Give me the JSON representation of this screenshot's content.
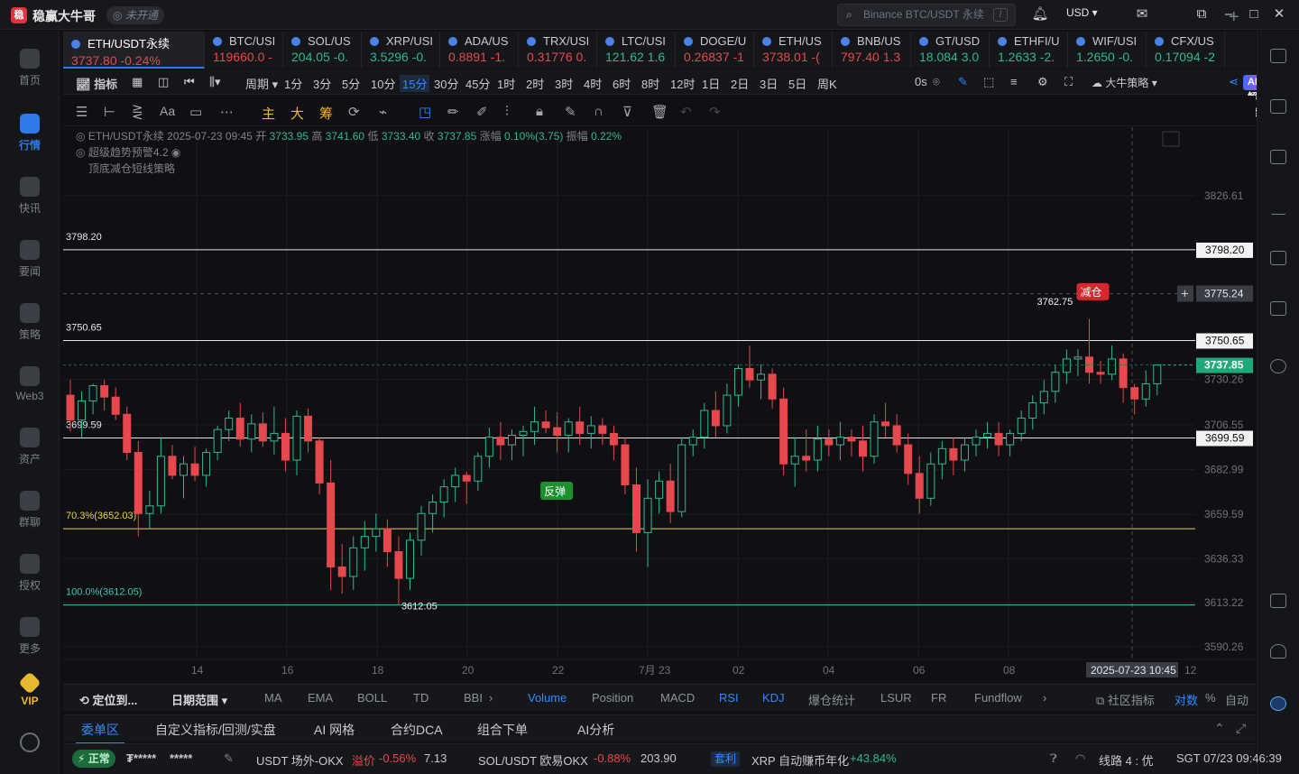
{
  "app": {
    "logo": "稳",
    "title": "稳赢大牛哥",
    "login_status": "未开通",
    "search_placeholder": "Binance BTC/USDT 永续",
    "search_hint": "/",
    "currency": "USD"
  },
  "left_nav": [
    {
      "label": "首页",
      "icon": "home-icon"
    },
    {
      "label": "行情",
      "icon": "market-chart-icon",
      "active": true
    },
    {
      "label": "快讯",
      "icon": "flash-news-icon"
    },
    {
      "label": "要闻",
      "icon": "news-icon"
    },
    {
      "label": "策略",
      "icon": "strategy-robot-icon"
    },
    {
      "label": "Web3",
      "icon": "web3-icon"
    },
    {
      "label": "资产",
      "icon": "wallet-icon"
    },
    {
      "label": "群聊",
      "icon": "chat-icon"
    },
    {
      "label": "授权",
      "icon": "authorize-icon"
    },
    {
      "label": "更多",
      "icon": "more-grid-icon"
    },
    {
      "label": "VIP",
      "icon": "vip-diamond-icon"
    }
  ],
  "tabs": [
    {
      "name": "ETH/USDT永续",
      "price": "3737.80",
      "change": "-0.24%",
      "dir": "dn",
      "active": true
    },
    {
      "name": "BTC/USI",
      "price": "119660.0",
      "change": "-",
      "dir": "dn"
    },
    {
      "name": "SOL/US",
      "price": "204.05",
      "change": "-0.",
      "dir": "up"
    },
    {
      "name": "XRP/USI",
      "price": "3.5296",
      "change": "-0.",
      "dir": "up"
    },
    {
      "name": "ADA/US",
      "price": "0.8891",
      "change": "-1.",
      "dir": "dn"
    },
    {
      "name": "TRX/USI",
      "price": "0.31776",
      "change": "0.",
      "dir": "dn"
    },
    {
      "name": "LTC/USI",
      "price": "121.62",
      "change": "1.6",
      "dir": "up"
    },
    {
      "name": "DOGE/U",
      "price": "0.26837",
      "change": "-1",
      "dir": "dn"
    },
    {
      "name": "ETH/US",
      "price": "3738.01",
      "change": "-(",
      "dir": "dn"
    },
    {
      "name": "BNB/US",
      "price": "797.40",
      "change": "1.3",
      "dir": "dn"
    },
    {
      "name": "GT/USD",
      "price": "18.084",
      "change": "3.0",
      "dir": "up"
    },
    {
      "name": "ETHFI/U",
      "price": "1.2633",
      "change": "-2.",
      "dir": "up"
    },
    {
      "name": "WIF/USI",
      "price": "1.2650",
      "change": "-0.",
      "dir": "up"
    },
    {
      "name": "CFX/US",
      "price": "0.17094",
      "change": "-2",
      "dir": "up"
    }
  ],
  "toolbar": {
    "indicator": "指标",
    "period": "周期",
    "timeframes": [
      "1分",
      "3分",
      "5分",
      "10分",
      "15分",
      "30分",
      "45分",
      "1时",
      "2时",
      "3时",
      "4时",
      "6时",
      "8时",
      "12时",
      "1日",
      "2日",
      "3日",
      "5日",
      "周K"
    ],
    "active_tf": "15分",
    "countdown": "0s",
    "strategy": "大牛策略",
    "ai": "AI解读"
  },
  "draw_tools": [
    "主",
    "大",
    "筹"
  ],
  "chart_info": {
    "symbol": "ETH/USDT永续",
    "datetime": "2025-07-23 09:45",
    "open_label": "开",
    "open": "3733.95",
    "high_label": "高",
    "high": "3741.60",
    "low_label": "低",
    "low": "3733.40",
    "close_label": "收",
    "close": "3737.85",
    "chg_label": "涨幅",
    "chg": "0.10%(3.75)",
    "amp_label": "振幅",
    "amp": "0.22%",
    "indicator1": "超级趋势预警4.2",
    "indicator2": "顶底减仓短线策略"
  },
  "chart_data": {
    "type": "candlestick",
    "x_ticks": [
      "14",
      "16",
      "18",
      "20",
      "22",
      "7月 23",
      "02",
      "04",
      "06",
      "08",
      "12"
    ],
    "crosshair_time": "2025-07-23 10:45",
    "y_ticks": [
      "3826.61",
      "3730.26",
      "3706.55",
      "3682.99",
      "3659.59",
      "3636.33",
      "3613.22",
      "3590.26"
    ],
    "levels": [
      {
        "label": "3798.20",
        "value": 3798.2,
        "color": "#e6e6e6"
      },
      {
        "label": "3750.65",
        "value": 3750.65,
        "color": "#e6e6e6"
      },
      {
        "label": "3699.59",
        "value": 3699.59,
        "color": "#e6e6e6"
      },
      {
        "label": "70.3%(3652.03)",
        "value": 3652.03,
        "color": "#e8d24a"
      },
      {
        "label": "100.0%(3612.05)",
        "value": 3612.05,
        "color": "#3fc7b0"
      }
    ],
    "crosshair_price": "3775.24",
    "last_price": "3737.85",
    "high_mark": "3762.75",
    "low_mark": "3612.05",
    "signal_sell": "减仓",
    "signal_buy": "反弹",
    "candles": [
      [
        3722,
        3730,
        3703,
        3709
      ],
      [
        3709,
        3724,
        3700,
        3719
      ],
      [
        3719,
        3728,
        3712,
        3727
      ],
      [
        3727,
        3730,
        3714,
        3721
      ],
      [
        3721,
        3726,
        3709,
        3712
      ],
      [
        3712,
        3716,
        3688,
        3692
      ],
      [
        3692,
        3698,
        3648,
        3660
      ],
      [
        3660,
        3672,
        3652,
        3664
      ],
      [
        3664,
        3700,
        3660,
        3690
      ],
      [
        3690,
        3696,
        3678,
        3680
      ],
      [
        3680,
        3690,
        3668,
        3686
      ],
      [
        3686,
        3695,
        3677,
        3680
      ],
      [
        3680,
        3694,
        3674,
        3692
      ],
      [
        3692,
        3706,
        3688,
        3704
      ],
      [
        3704,
        3714,
        3698,
        3710
      ],
      [
        3710,
        3718,
        3695,
        3699
      ],
      [
        3699,
        3712,
        3692,
        3707
      ],
      [
        3707,
        3713,
        3695,
        3698
      ],
      [
        3698,
        3716,
        3691,
        3702
      ],
      [
        3702,
        3710,
        3682,
        3688
      ],
      [
        3688,
        3714,
        3680,
        3711
      ],
      [
        3711,
        3715,
        3692,
        3698
      ],
      [
        3698,
        3700,
        3670,
        3676
      ],
      [
        3676,
        3688,
        3620,
        3632
      ],
      [
        3632,
        3644,
        3618,
        3627
      ],
      [
        3627,
        3648,
        3620,
        3642
      ],
      [
        3642,
        3656,
        3630,
        3648
      ],
      [
        3648,
        3660,
        3640,
        3652
      ],
      [
        3652,
        3657,
        3632,
        3640
      ],
      [
        3640,
        3648,
        3612,
        3626
      ],
      [
        3626,
        3650,
        3620,
        3646
      ],
      [
        3646,
        3664,
        3638,
        3660
      ],
      [
        3660,
        3670,
        3650,
        3666
      ],
      [
        3666,
        3678,
        3658,
        3674
      ],
      [
        3674,
        3684,
        3666,
        3680
      ],
      [
        3680,
        3682,
        3665,
        3677
      ],
      [
        3677,
        3692,
        3672,
        3690
      ],
      [
        3690,
        3705,
        3684,
        3700
      ],
      [
        3700,
        3708,
        3688,
        3696
      ],
      [
        3696,
        3704,
        3688,
        3701
      ],
      [
        3701,
        3706,
        3690,
        3703
      ],
      [
        3703,
        3716,
        3696,
        3708
      ],
      [
        3708,
        3714,
        3702,
        3705
      ],
      [
        3705,
        3713,
        3692,
        3701
      ],
      [
        3701,
        3710,
        3692,
        3708
      ],
      [
        3708,
        3716,
        3696,
        3702
      ],
      [
        3702,
        3711,
        3694,
        3706
      ],
      [
        3706,
        3710,
        3696,
        3702
      ],
      [
        3702,
        3706,
        3688,
        3696
      ],
      [
        3696,
        3700,
        3670,
        3675
      ],
      [
        3675,
        3684,
        3640,
        3650
      ],
      [
        3650,
        3678,
        3632,
        3668
      ],
      [
        3668,
        3682,
        3660,
        3677
      ],
      [
        3677,
        3686,
        3655,
        3661
      ],
      [
        3661,
        3700,
        3658,
        3696
      ],
      [
        3696,
        3704,
        3690,
        3700
      ],
      [
        3700,
        3718,
        3694,
        3714
      ],
      [
        3714,
        3724,
        3700,
        3706
      ],
      [
        3706,
        3728,
        3702,
        3722
      ],
      [
        3722,
        3738,
        3716,
        3736
      ],
      [
        3736,
        3748,
        3726,
        3730
      ],
      [
        3730,
        3738,
        3720,
        3733
      ],
      [
        3733,
        3736,
        3715,
        3720
      ],
      [
        3720,
        3726,
        3680,
        3686
      ],
      [
        3686,
        3700,
        3674,
        3690
      ],
      [
        3690,
        3704,
        3682,
        3688
      ],
      [
        3688,
        3706,
        3682,
        3699
      ],
      [
        3699,
        3704,
        3690,
        3696
      ],
      [
        3696,
        3708,
        3688,
        3700
      ],
      [
        3700,
        3704,
        3690,
        3698
      ],
      [
        3698,
        3706,
        3682,
        3690
      ],
      [
        3690,
        3712,
        3686,
        3708
      ],
      [
        3708,
        3718,
        3700,
        3706
      ],
      [
        3706,
        3712,
        3692,
        3696
      ],
      [
        3696,
        3702,
        3675,
        3681
      ],
      [
        3681,
        3690,
        3660,
        3668
      ],
      [
        3668,
        3692,
        3664,
        3686
      ],
      [
        3686,
        3698,
        3678,
        3694
      ],
      [
        3694,
        3700,
        3680,
        3688
      ],
      [
        3688,
        3700,
        3682,
        3696
      ],
      [
        3696,
        3704,
        3690,
        3700
      ],
      [
        3700,
        3708,
        3694,
        3702
      ],
      [
        3702,
        3708,
        3690,
        3696
      ],
      [
        3696,
        3704,
        3690,
        3702
      ],
      [
        3702,
        3714,
        3698,
        3710
      ],
      [
        3710,
        3722,
        3704,
        3718
      ],
      [
        3718,
        3730,
        3712,
        3724
      ],
      [
        3724,
        3738,
        3718,
        3734
      ],
      [
        3734,
        3746,
        3728,
        3741
      ],
      [
        3741,
        3746,
        3732,
        3742
      ],
      [
        3742,
        3762,
        3728,
        3734
      ],
      [
        3734,
        3740,
        3728,
        3733
      ],
      [
        3733,
        3748,
        3730,
        3741
      ],
      [
        3741,
        3744,
        3718,
        3726
      ],
      [
        3726,
        3728,
        3712,
        3720
      ],
      [
        3720,
        3735,
        3716,
        3728
      ],
      [
        3728,
        3738,
        3722,
        3737.85
      ]
    ]
  },
  "bottom_indicators": {
    "locate": "定位到...",
    "range": "日期范围",
    "items": [
      "MA",
      "EMA",
      "BOLL",
      "TD",
      "BBI",
      "Volume",
      "Position",
      "MACD",
      "RSI",
      "KDJ",
      "爆仓统计",
      "LSUR",
      "FR",
      "Fundflow"
    ],
    "community": "社区指标",
    "log": "对数",
    "percent": "%",
    "auto": "自动"
  },
  "panel_tabs": [
    "委单区",
    "自定义指标/回测/实盘",
    "AI 网格",
    "合约DCA",
    "组合下单",
    "AI分析"
  ],
  "status": {
    "conn": "正常",
    "masked1": "₮*****",
    "masked2": "*****",
    "otc_label": "USDT 场外-OKX",
    "otc_premium_label": "溢价",
    "otc_premium": "-0.56%",
    "otc_price": "7.13",
    "sol_label": "SOL/USDT 欧易OKX",
    "sol_change": "-0.88%",
    "sol_price": "203.90",
    "arb_label": "套利",
    "xrp_label": "XRP 自动赚币年化",
    "xrp_rate": "+43.84%",
    "line_label": "线路 4 : 优",
    "clock": "SGT 07/23 09:46:39"
  },
  "colors": {
    "up": "#2db98a",
    "down": "#e5484d",
    "accent": "#2f79e8"
  }
}
